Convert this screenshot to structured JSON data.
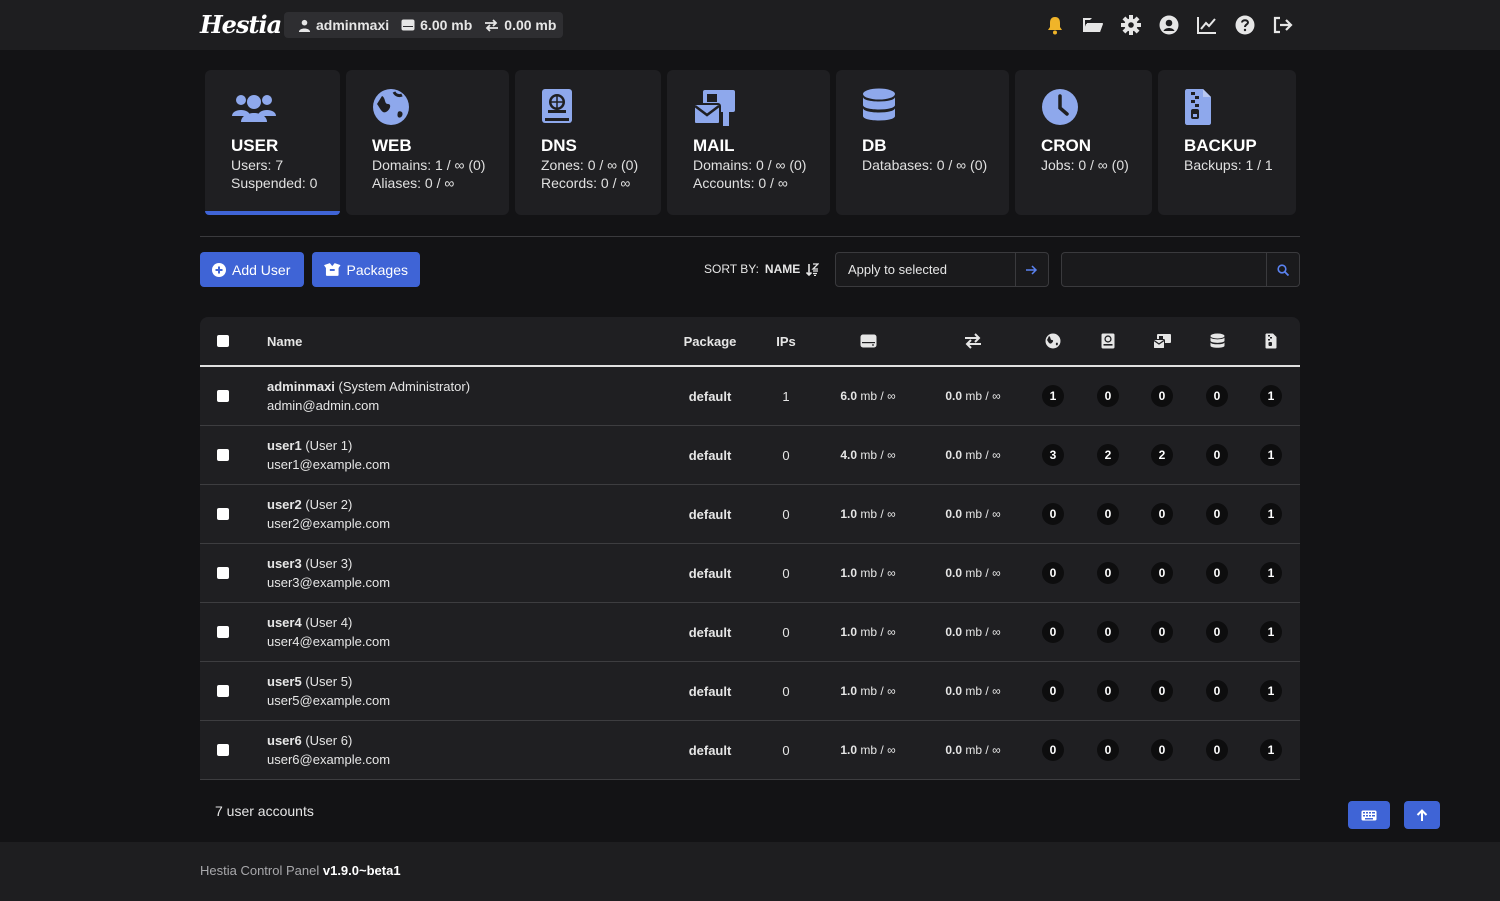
{
  "header": {
    "logo": "Hestia",
    "user": "adminmaxi",
    "disk": "6.00 mb",
    "bandwidth": "0.00 mb",
    "icons": [
      "bell-icon",
      "folder-icon",
      "gear-icon",
      "user-circle-icon",
      "chart-icon",
      "help-icon",
      "logout-icon"
    ],
    "notification_color": "#f0b429"
  },
  "cards": [
    {
      "title": "USER",
      "lines": [
        "Users: 7",
        "Suspended: 0"
      ],
      "icon": "users-icon",
      "active": true
    },
    {
      "title": "WEB",
      "lines": [
        "Domains: 1 / ∞ (0)",
        "Aliases: 0 / ∞"
      ],
      "icon": "globe-icon"
    },
    {
      "title": "DNS",
      "lines": [
        "Zones: 0 / ∞ (0)",
        "Records: 0 / ∞"
      ],
      "icon": "dns-book-icon"
    },
    {
      "title": "MAIL",
      "lines": [
        "Domains: 0 / ∞ (0)",
        "Accounts: 0 / ∞"
      ],
      "icon": "mail-icon"
    },
    {
      "title": "DB",
      "lines": [
        "Databases: 0 / ∞ (0)"
      ],
      "icon": "database-icon"
    },
    {
      "title": "CRON",
      "lines": [
        "Jobs: 0 / ∞ (0)"
      ],
      "icon": "clock-icon"
    },
    {
      "title": "BACKUP",
      "lines": [
        "Backups: 1 / 1"
      ],
      "icon": "file-zipper-icon"
    }
  ],
  "toolbar": {
    "add_user": "Add User",
    "packages": "Packages",
    "sort_label": "SORT BY:",
    "sort_value": "NAME",
    "apply_selected": "Apply to selected",
    "search_placeholder": ""
  },
  "table": {
    "headers": {
      "name": "Name",
      "package": "Package",
      "ips": "IPs"
    },
    "rows": [
      {
        "user": "adminmaxi",
        "full": "(System Administrator)",
        "email": "admin@admin.com",
        "package": "default",
        "ips": "1",
        "disk_val": "6.0",
        "disk_rest": " mb / ∞",
        "bw_val": "0.0",
        "bw_rest": " mb / ∞",
        "web": "1",
        "dns": "0",
        "mail": "0",
        "db": "0",
        "backup": "1"
      },
      {
        "user": "user1",
        "full": "(User 1)",
        "email": "user1@example.com",
        "package": "default",
        "ips": "0",
        "disk_val": "4.0",
        "disk_rest": " mb / ∞",
        "bw_val": "0.0",
        "bw_rest": " mb / ∞",
        "web": "3",
        "dns": "2",
        "mail": "2",
        "db": "0",
        "backup": "1"
      },
      {
        "user": "user2",
        "full": "(User 2)",
        "email": "user2@example.com",
        "package": "default",
        "ips": "0",
        "disk_val": "1.0",
        "disk_rest": " mb / ∞",
        "bw_val": "0.0",
        "bw_rest": " mb / ∞",
        "web": "0",
        "dns": "0",
        "mail": "0",
        "db": "0",
        "backup": "1"
      },
      {
        "user": "user3",
        "full": "(User 3)",
        "email": "user3@example.com",
        "package": "default",
        "ips": "0",
        "disk_val": "1.0",
        "disk_rest": " mb / ∞",
        "bw_val": "0.0",
        "bw_rest": " mb / ∞",
        "web": "0",
        "dns": "0",
        "mail": "0",
        "db": "0",
        "backup": "1"
      },
      {
        "user": "user4",
        "full": "(User 4)",
        "email": "user4@example.com",
        "package": "default",
        "ips": "0",
        "disk_val": "1.0",
        "disk_rest": " mb / ∞",
        "bw_val": "0.0",
        "bw_rest": " mb / ∞",
        "web": "0",
        "dns": "0",
        "mail": "0",
        "db": "0",
        "backup": "1"
      },
      {
        "user": "user5",
        "full": "(User 5)",
        "email": "user5@example.com",
        "package": "default",
        "ips": "0",
        "disk_val": "1.0",
        "disk_rest": " mb / ∞",
        "bw_val": "0.0",
        "bw_rest": " mb / ∞",
        "web": "0",
        "dns": "0",
        "mail": "0",
        "db": "0",
        "backup": "1"
      },
      {
        "user": "user6",
        "full": "(User 6)",
        "email": "user6@example.com",
        "package": "default",
        "ips": "0",
        "disk_val": "1.0",
        "disk_rest": " mb / ∞",
        "bw_val": "0.0",
        "bw_rest": " mb / ∞",
        "web": "0",
        "dns": "0",
        "mail": "0",
        "db": "0",
        "backup": "1"
      }
    ]
  },
  "summary": "7 user accounts",
  "footer": {
    "name": "Hestia Control Panel",
    "version": "v1.9.0~beta1"
  },
  "colors": {
    "accent": "#3f64d6",
    "icon_accent": "#8ea8ec",
    "background": "#131315",
    "panel": "#1f1f22"
  }
}
